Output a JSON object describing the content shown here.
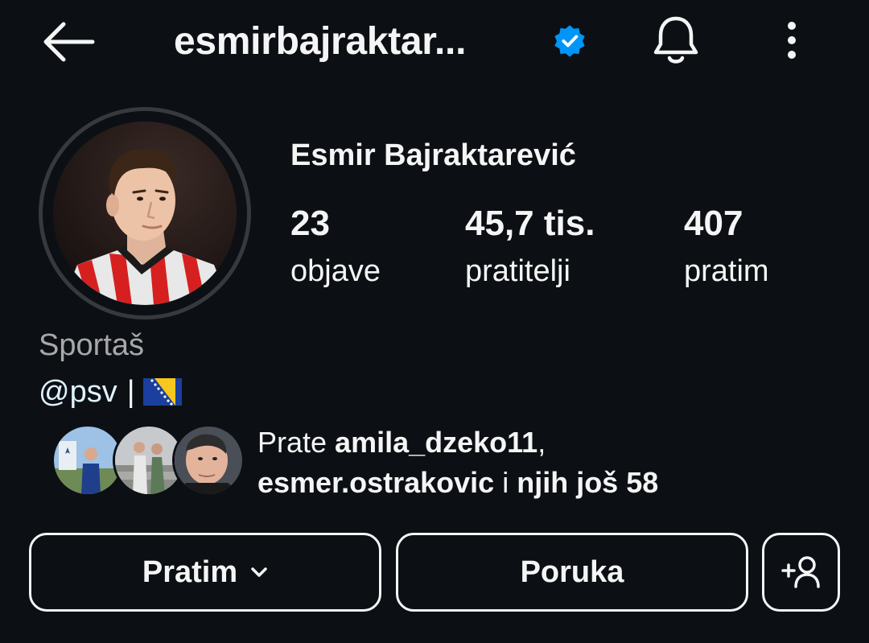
{
  "header": {
    "username": "esmirbajraktar...",
    "back_icon": "arrow-left-icon",
    "verified_icon": "verified-badge-icon",
    "notifications_icon": "bell-icon",
    "more_icon": "more-vertical-icon"
  },
  "profile": {
    "full_name": "Esmir Bajraktarević",
    "avatar_icon": "profile-photo",
    "stats": [
      {
        "value": "23",
        "label": "objave"
      },
      {
        "value": "45,7 tis.",
        "label": "pratitelji"
      },
      {
        "value": "407",
        "label": "pratim"
      }
    ],
    "category": "Sportaš",
    "bio": {
      "link": "@psv",
      "separator": "|",
      "flag_icon": "bosnia-flag-icon"
    }
  },
  "followed_by": {
    "prefix": "Prate ",
    "user1": "amila_dzeko11",
    "comma": ",",
    "user2": "esmer.ostrakovic",
    "suffix_word": " i ",
    "suffix": "njih još 58"
  },
  "actions": {
    "follow_label": "Pratim",
    "message_label": "Poruka",
    "add_icon": "add-person-icon"
  },
  "colors": {
    "background": "#0c1014",
    "text": "#f5f5f5",
    "secondary_text": "#a8a8a8",
    "link": "#e0f1ff",
    "verified": "#0095f6"
  }
}
